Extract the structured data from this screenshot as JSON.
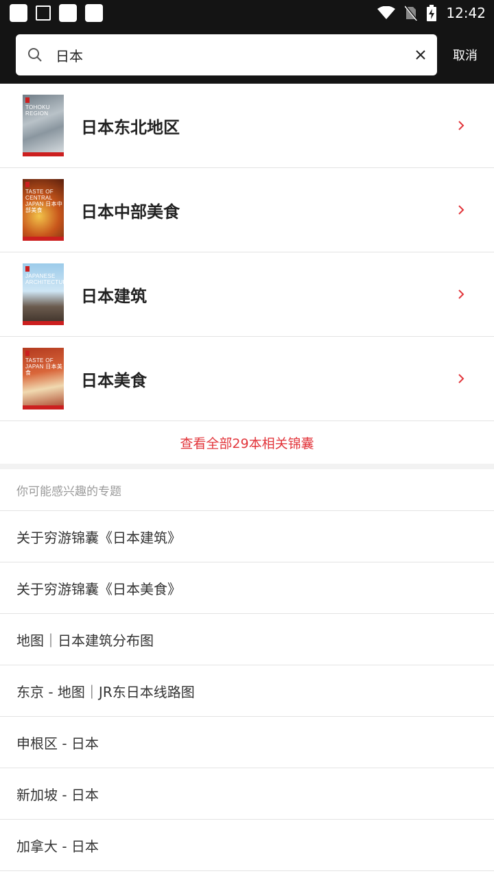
{
  "status_bar": {
    "time": "12:42"
  },
  "search": {
    "query": "日本",
    "cancel_label": "取消"
  },
  "books": [
    {
      "title": "日本东北地区",
      "cover_text": "TOHOKU REGION"
    },
    {
      "title": "日本中部美食",
      "cover_text": "TASTE OF CENTRAL JAPAN 日本中部美食"
    },
    {
      "title": "日本建筑",
      "cover_text": "JAPANESE ARCHITECTURE"
    },
    {
      "title": "日本美食",
      "cover_text": "TASTE OF JAPAN 日本美食"
    }
  ],
  "view_all_label": "查看全部29本相关锦囊",
  "topics_section_title": "你可能感兴趣的专题",
  "topics": [
    "关于穷游锦囊《日本建筑》",
    "关于穷游锦囊《日本美食》",
    "地图｜日本建筑分布图",
    "东京 - 地图｜JR东日本线路图",
    "申根区 - 日本",
    "新加坡 - 日本",
    "加拿大 - 日本"
  ],
  "colors": {
    "accent": "#e2353b",
    "header_bg": "#141414",
    "divider": "#e3e3e3"
  }
}
